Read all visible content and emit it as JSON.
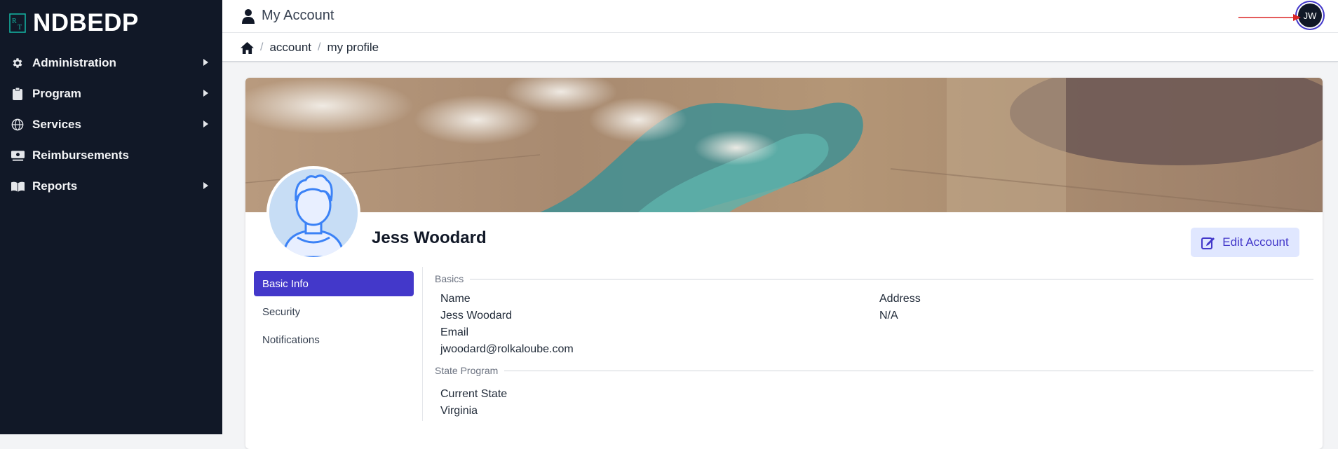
{
  "brand": {
    "name": "NDBEDP",
    "logo_icon": "rt-logo-icon"
  },
  "sidebar": {
    "items": [
      {
        "label": "Administration",
        "icon": "gear-icon",
        "has_submenu": true
      },
      {
        "label": "Program",
        "icon": "clipboard-icon",
        "has_submenu": true
      },
      {
        "label": "Services",
        "icon": "globe-icon",
        "has_submenu": true
      },
      {
        "label": "Reimbursements",
        "icon": "money-icon",
        "has_submenu": false
      },
      {
        "label": "Reports",
        "icon": "book-icon",
        "has_submenu": true
      }
    ]
  },
  "header": {
    "title": "My Account",
    "user_initials": "JW"
  },
  "breadcrumb": {
    "items": [
      "account",
      "my profile"
    ]
  },
  "profile": {
    "name": "Jess Woodard",
    "edit_button_label": "Edit Account"
  },
  "tabs": [
    {
      "label": "Basic Info",
      "active": true
    },
    {
      "label": "Security",
      "active": false
    },
    {
      "label": "Notifications",
      "active": false
    }
  ],
  "basics": {
    "section_title": "Basics",
    "name_label": "Name",
    "name_value": "Jess Woodard",
    "email_label": "Email",
    "email_value": "jwoodard@rolkaloube.com",
    "address_label": "Address",
    "address_value": "N/A"
  },
  "state_program": {
    "section_title": "State Program",
    "current_state_label": "Current State",
    "current_state_value": "Virginia"
  },
  "colors": {
    "sidebar_bg": "#111827",
    "accent": "#4338ca",
    "accent_light": "#e0e7ff",
    "annotation_arrow": "#dc2626"
  }
}
